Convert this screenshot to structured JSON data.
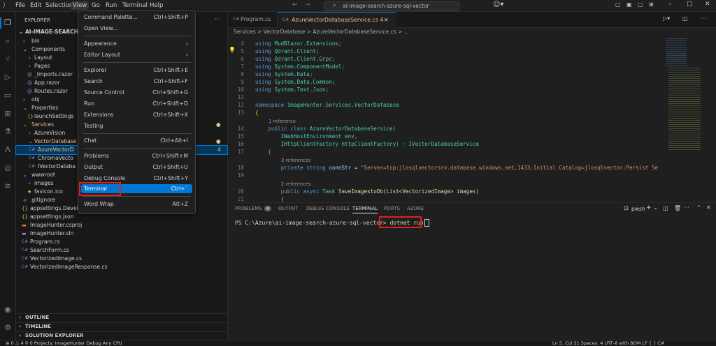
{
  "titlebar": {
    "menus": [
      "File",
      "Edit",
      "Selection",
      "View",
      "Go",
      "Run",
      "Terminal",
      "Help"
    ],
    "search_text": "ai-image-search-azure-sql-vector"
  },
  "view_menu": {
    "items": [
      {
        "label": "Command Palette...",
        "shortcut": "Ctrl+Shift+P"
      },
      {
        "label": "Open View...",
        "shortcut": ""
      },
      {
        "label": "Appearance",
        "shortcut": "",
        "submenu": true
      },
      {
        "label": "Editor Layout",
        "shortcut": "",
        "submenu": true
      },
      {
        "label": "Explorer",
        "shortcut": "Ctrl+Shift+E"
      },
      {
        "label": "Search",
        "shortcut": "Ctrl+Shift+F"
      },
      {
        "label": "Source Control",
        "shortcut": "Ctrl+Shift+G"
      },
      {
        "label": "Run",
        "shortcut": "Ctrl+Shift+D"
      },
      {
        "label": "Extensions",
        "shortcut": "Ctrl+Shift+X"
      },
      {
        "label": "Testing",
        "shortcut": ""
      },
      {
        "label": "Chat",
        "shortcut": "Ctrl+Alt+I"
      },
      {
        "label": "Problems",
        "shortcut": "Ctrl+Shift+M"
      },
      {
        "label": "Output",
        "shortcut": "Ctrl+Shift+U"
      },
      {
        "label": "Debug Console",
        "shortcut": "Ctrl+Shift+Y"
      },
      {
        "label": "Terminal",
        "shortcut": "Ctrl+`"
      },
      {
        "label": "Word Wrap",
        "shortcut": "Alt+Z"
      }
    ]
  },
  "sidebar": {
    "title": "EXPLORER",
    "root": "AI-IMAGE-SEARCH-A",
    "tree": [
      {
        "label": "bin",
        "icon": "›"
      },
      {
        "label": "Components",
        "icon": "⌄"
      },
      {
        "label": "Layout",
        "icon": "›"
      },
      {
        "label": "Pages",
        "icon": "›"
      },
      {
        "label": "_Imports.razor",
        "icon": "@"
      },
      {
        "label": "App.razor",
        "icon": "@"
      },
      {
        "label": "Routes.razor",
        "icon": "@"
      },
      {
        "label": "obj",
        "icon": "›"
      },
      {
        "label": "Properties",
        "icon": "⌄"
      },
      {
        "label": "launchSettings",
        "icon": "{}"
      },
      {
        "label": "Services",
        "icon": "⌄"
      },
      {
        "label": "AzureVision",
        "icon": "›"
      },
      {
        "label": "VectorDatabase",
        "icon": "⌄"
      },
      {
        "label": "AzureVectorD",
        "icon": "C#"
      },
      {
        "label": "ChromaVecto",
        "icon": "C#"
      },
      {
        "label": "IVectorDataba",
        "icon": "C#"
      },
      {
        "label": "wwwroot",
        "icon": "⌄"
      },
      {
        "label": "images",
        "icon": "›"
      },
      {
        "label": "favicon.ico",
        "icon": "★"
      },
      {
        "label": ".gitignore",
        "icon": "◆"
      },
      {
        "label": "appsettings.Development.json",
        "icon": "{}"
      },
      {
        "label": "appsettings.json",
        "icon": "{}"
      },
      {
        "label": "ImageHunter.csproj",
        "icon": "▬"
      },
      {
        "label": "ImageHunter.sln",
        "icon": "▬"
      },
      {
        "label": "Program.cs",
        "icon": "C#"
      },
      {
        "label": "SearchForm.cs",
        "icon": "C#"
      },
      {
        "label": "VectorizedImage.cs",
        "icon": "C#"
      },
      {
        "label": "VectorizedImageResponse.cs",
        "icon": "C#"
      }
    ],
    "problem_count": "4",
    "sections": [
      "OUTLINE",
      "TIMELINE",
      "SOLUTION EXPLORER"
    ]
  },
  "tabs": [
    {
      "label": "Program.cs"
    },
    {
      "label": "AzureVectorDatabaseService.cs 4"
    }
  ],
  "breadcrumbs": "Services > VectorDatabase > AzureVectorDatabaseService.cs > ...",
  "code": {
    "line_numbers": [
      "4",
      "5",
      "6",
      "7",
      "8",
      "9",
      "10",
      "11",
      "12",
      "13",
      "",
      "14",
      "15",
      "16",
      "17",
      "",
      "18",
      "19",
      "",
      "20",
      "21"
    ],
    "using_lines": [
      "MudBlazor.Extensions;",
      "Qdrant.Client;",
      "Qdrant.Client.Grpc;",
      "System.ComponentModel;",
      "System.Data;",
      "System.Data.Common;",
      "System.Text.Json;"
    ],
    "namespace_kw": "namespace",
    "namespace_name": "ImageHunter.Services.VectorDatabase",
    "ref1": "1 reference",
    "ref3": "3 references",
    "ref2": "2 references",
    "using_kw": "using",
    "class_line": "AzureVectorDatabaseService(",
    "env_param": "IWebHostEnvironment env,",
    "factory_param": "IHttpClientFactory httpClientFactory) : IVectorDatabaseService",
    "connstr_line": "\"Server=tcp:jlosqlvectorsrv.database.windows.net,1433;Initial Catalog=jlosqlvector;Persist Se",
    "save_line": "SaveImagestoDb(List<VectorizedImage> images)"
  },
  "panel": {
    "tabs": [
      "PROBLEMS",
      "OUTPUT",
      "DEBUG CONSOLE",
      "TERMINAL",
      "PORTS",
      "AZURE"
    ],
    "problems_badge": "4",
    "shell": "pwsh",
    "prompt": "PS C:\\Azure\\ai-image-search-azure-sql-vector>",
    "command": "dotnet run"
  },
  "statusbar": {
    "left": "⊗ 0 ⚠ 4   ⚲ 0   Projects: ImageHunter   Debug Any CPU",
    "right": "Ln 5, Col 21   Spaces: 4   UTF-8 with BOM   LF   { } C#"
  },
  "colors": {
    "accent": "#0078d4",
    "highlight_box": "#e21f1f"
  }
}
